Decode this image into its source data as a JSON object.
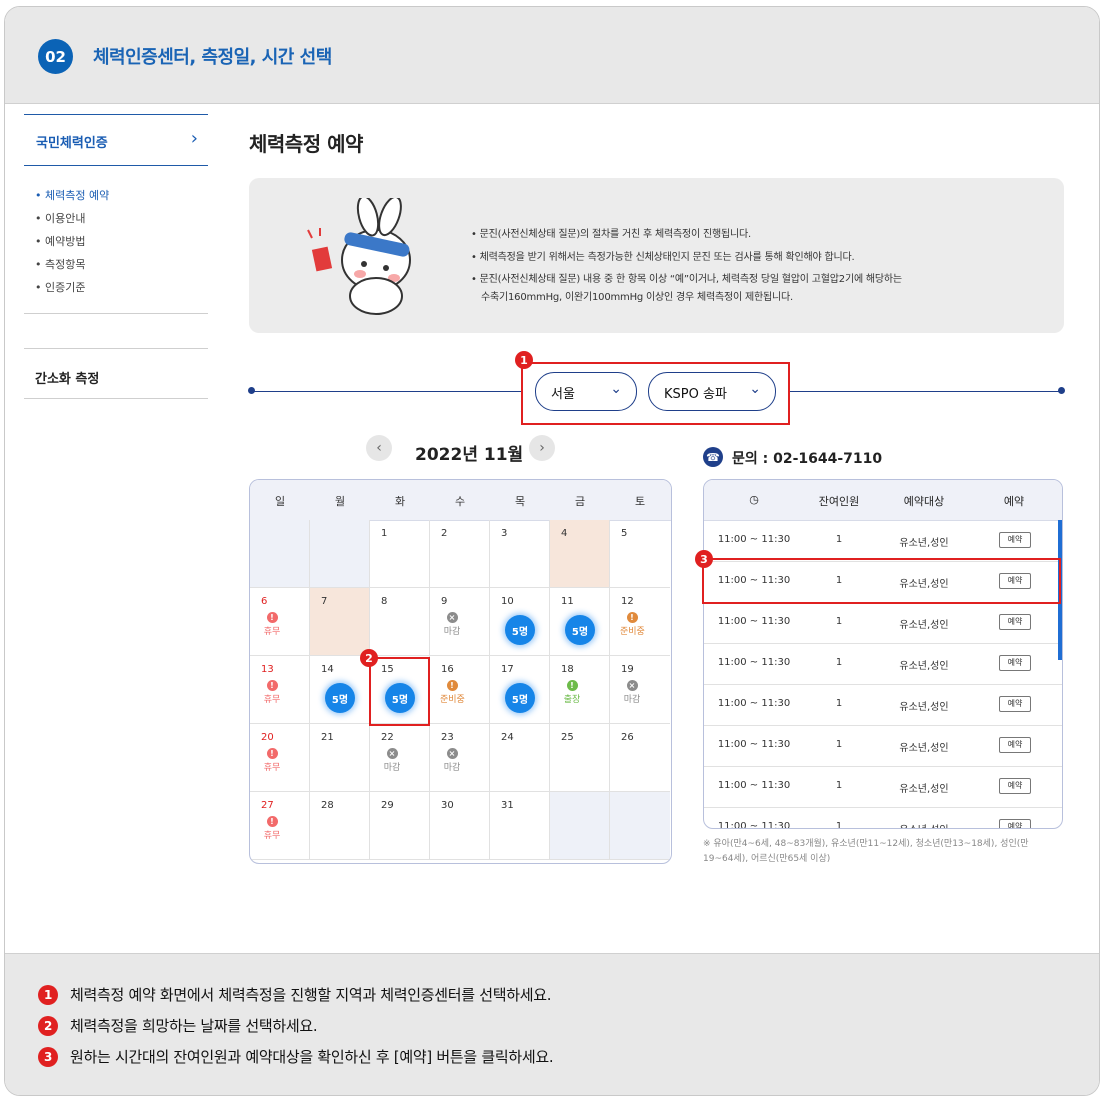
{
  "header": {
    "step": "02",
    "title": "체력인증센터, 측정일, 시간 선택"
  },
  "sidebar": {
    "main_item": "국민체력인증",
    "sub_items": [
      {
        "label": "• 체력측정 예약",
        "active": true
      },
      {
        "label": "• 이용안내",
        "active": false
      },
      {
        "label": "• 예약방법",
        "active": false
      },
      {
        "label": "• 측정항목",
        "active": false
      },
      {
        "label": "• 인증기준",
        "active": false
      }
    ],
    "second_item": "간소화 측정"
  },
  "main": {
    "title": "체력측정 예약",
    "info_lines": [
      "• 문진(사전신체상태 질문)의 절차를 거친 후 체력측정이 진행됩니다.",
      "• 체력측정을 받기 위해서는 측정가능한 신체상태인지 문진 또는 검사를 통해 확인해야 합니다.",
      "• 문진(사전신체상태 질문) 내용 중 한 항목 이상 “예”이거나, 체력측정 당일 혈압이 고혈압2기에 해당하는",
      "  수축기160mmHg, 이완기100mmHg 이상인 경우 체력측정이 제한됩니다."
    ],
    "region_select": "서울",
    "center_select": "KSPO 송파",
    "badge1": "1",
    "badge2": "2",
    "badge3": "3"
  },
  "calendar": {
    "month_label": "2022년 11월",
    "weekdays": [
      "일",
      "월",
      "화",
      "수",
      "목",
      "금",
      "토"
    ],
    "status_legend": {
      "closed_holiday": "휴무",
      "deadline": "마감",
      "preparing": "준비중",
      "trip": "출장",
      "available": "5명"
    }
  },
  "calendar_rows": [
    [
      {
        "d": ""
      },
      {
        "d": ""
      },
      {
        "d": "1"
      },
      {
        "d": "2"
      },
      {
        "d": "3"
      },
      {
        "d": "4",
        "bg": "peach"
      },
      {
        "d": "5"
      }
    ],
    [
      {
        "d": "6",
        "s": "휴무"
      },
      {
        "d": "7",
        "bg": "peach"
      },
      {
        "d": "8"
      },
      {
        "d": "9",
        "s": "마감"
      },
      {
        "d": "10",
        "s": "5명"
      },
      {
        "d": "11",
        "s": "5명"
      },
      {
        "d": "12",
        "s": "준비중"
      }
    ],
    [
      {
        "d": "13",
        "s": "휴무"
      },
      {
        "d": "14",
        "s": "5명"
      },
      {
        "d": "15",
        "s": "5명"
      },
      {
        "d": "16",
        "s": "준비중"
      },
      {
        "d": "17",
        "s": "5명"
      },
      {
        "d": "18",
        "s": "출장"
      },
      {
        "d": "19",
        "s": "마감"
      }
    ],
    [
      {
        "d": "20",
        "s": "휴무"
      },
      {
        "d": "21"
      },
      {
        "d": "22",
        "s": "마감"
      },
      {
        "d": "23",
        "s": "마감"
      },
      {
        "d": "24"
      },
      {
        "d": "25"
      },
      {
        "d": "26"
      }
    ],
    [
      {
        "d": "27",
        "s": "휴무"
      },
      {
        "d": "28"
      },
      {
        "d": "29"
      },
      {
        "d": "30"
      },
      {
        "d": "31"
      },
      {
        "d": ""
      },
      {
        "d": ""
      }
    ]
  ],
  "contact": {
    "label": "문의 : 02-1644-7110"
  },
  "time_table": {
    "headers": [
      "",
      "잔여인원",
      "예약대상",
      "예약"
    ],
    "rows": [
      {
        "time": "11:00 ~ 11:30",
        "remaining": "1",
        "target": "유소년,성인",
        "button": "예약"
      },
      {
        "time": "11:00 ~ 11:30",
        "remaining": "1",
        "target": "유소년,성인",
        "button": "예약"
      },
      {
        "time": "11:00 ~ 11:30",
        "remaining": "1",
        "target": "유소년,성인",
        "button": "예약"
      },
      {
        "time": "11:00 ~ 11:30",
        "remaining": "1",
        "target": "유소년,성인",
        "button": "예약"
      },
      {
        "time": "11:00 ~ 11:30",
        "remaining": "1",
        "target": "유소년,성인",
        "button": "예약"
      },
      {
        "time": "11:00 ~ 11:30",
        "remaining": "1",
        "target": "유소년,성인",
        "button": "예약"
      },
      {
        "time": "11:00 ~ 11:30",
        "remaining": "1",
        "target": "유소년,성인",
        "button": "예약"
      },
      {
        "time": "11:00 ~ 11:30",
        "remaining": "1",
        "target": "유소년,성인",
        "button": "예약"
      }
    ],
    "footnote": "※ 유아(만4~6세, 48~83개월), 유소년(만11~12세), 청소년(만13~18세), 성인(만19~64세), 어르신(만65세 이상)"
  },
  "notes": [
    {
      "num": "1",
      "text": "체력측정 예약 화면에서 체력측정을 진행할 지역과 체력인증센터를 선택하세요."
    },
    {
      "num": "2",
      "text": "체력측정을 희망하는 날짜를 선택하세요."
    },
    {
      "num": "3",
      "text": "원하는 시간대의 잔여인원과 예약대상을 확인하신 후 [예약] 버튼을 클릭하세요."
    }
  ],
  "colors": {
    "accent": "#1a64b5",
    "available": "#1685e8",
    "holiday": "#f26a6a",
    "deadline": "#8c8c8c",
    "preparing": "#e08a3c",
    "trip": "#6dbb4a",
    "highlight": "#e02020"
  }
}
